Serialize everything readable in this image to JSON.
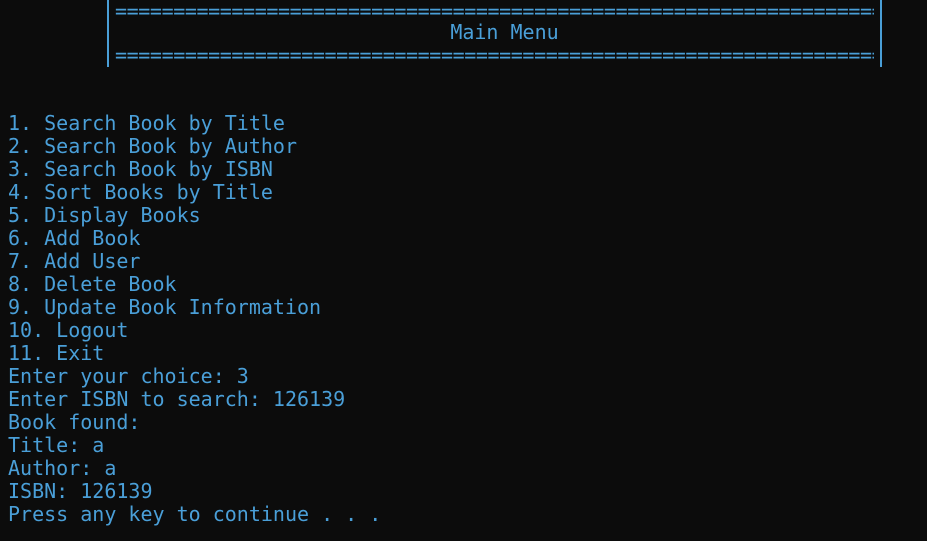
{
  "banner": {
    "rule": "======================================================================",
    "title": "Main Menu"
  },
  "menu": {
    "items": [
      "1. Search Book by Title",
      "2. Search Book by Author",
      "3. Search Book by ISBN",
      "4. Sort Books by Title",
      "5. Display Books",
      "6. Add Book",
      "7. Add User",
      "8. Delete Book",
      "9. Update Book Information",
      "10. Logout",
      "11. Exit"
    ]
  },
  "session": {
    "choice_prompt": "Enter your choice: 3",
    "isbn_prompt": "Enter ISBN to search: 126139",
    "result_heading": "Book found:",
    "title_line": "Title: a",
    "author_line": "Author: a",
    "isbn_line": "ISBN: 126139",
    "continue_prompt": "Press any key to continue . . ."
  },
  "colors": {
    "background": "#0c0c0c",
    "foreground": "#4a9fd8"
  }
}
